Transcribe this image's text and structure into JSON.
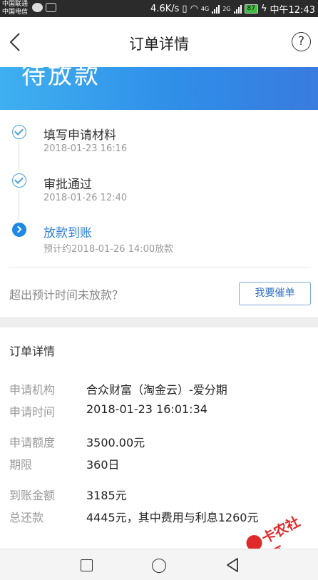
{
  "statusbar": {
    "carrier1": "中国联通",
    "carrier2": "中国电信",
    "speed": "4.6K/s",
    "net1": "4G",
    "net2": "2G",
    "battery": "87",
    "time": "中午12:43"
  },
  "header": {
    "title": "订单详情",
    "help": "?"
  },
  "banner": {
    "status": "待放款"
  },
  "progress": {
    "steps": [
      {
        "title": "填写申请材料",
        "sub": "2018-01-23 16:16"
      },
      {
        "title": "审批通过",
        "sub": "2018-01-26 12:40"
      },
      {
        "title": "放款到账",
        "sub": "预计约2018-01-26 14:00放款"
      }
    ],
    "overdue_text": "超出预计时间未放款？",
    "urge_button": "我要催单"
  },
  "detail": {
    "section_title": "订单详情",
    "rows": [
      {
        "label": "申请机构",
        "value": "合众财富（淘金云）-爱分期"
      },
      {
        "label": "申请时间",
        "value": "2018-01-23 16:01:34"
      },
      {
        "label": "申请额度",
        "value": "3500.00元"
      },
      {
        "label": "期限",
        "value": "360日"
      },
      {
        "label": "到账金额",
        "value": "3185元"
      },
      {
        "label": "总还款",
        "value": "4445元，其中费用与利息1260元"
      }
    ]
  },
  "watermark": {
    "text": "卡农社区"
  },
  "colors": {
    "accent": "#2e7fd6",
    "banner_start": "#3fb0f0",
    "banner_end": "#3a7be0",
    "watermark": "#e02a2a"
  }
}
